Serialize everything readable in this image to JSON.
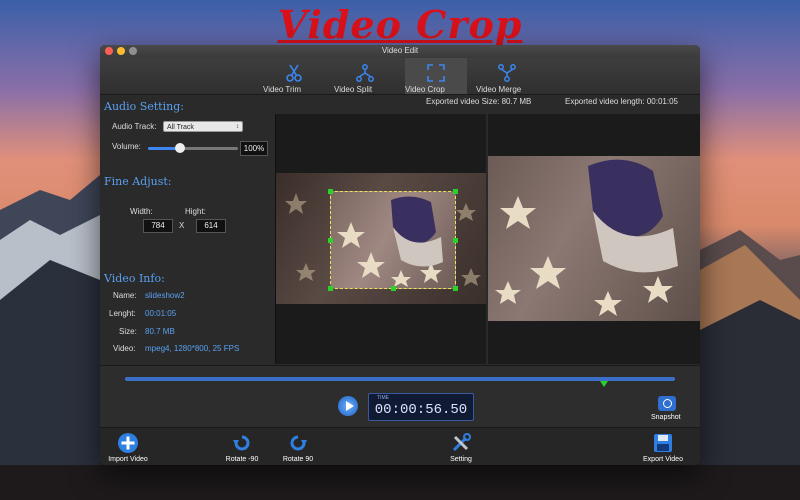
{
  "promo": {
    "title": "Video Crop"
  },
  "window": {
    "title": "Video Edit"
  },
  "tabs": [
    {
      "label": "Video Trim",
      "icon": "scissors-icon",
      "active": false
    },
    {
      "label": "Video Split",
      "icon": "split-icon",
      "active": false
    },
    {
      "label": "Video Crop",
      "icon": "crop-icon",
      "active": true
    },
    {
      "label": "Video Merge",
      "icon": "merge-icon",
      "active": false
    }
  ],
  "export_info": {
    "size": "Exported video Size: 80.7 MB",
    "length": "Exported video length: 00:01:05"
  },
  "audio": {
    "section_title": "Audio Setting:",
    "track_label": "Audio Track:",
    "track_value": "All Track",
    "volume_label": "Volume:",
    "volume_value": "100%",
    "volume_level": 0.35
  },
  "fine_adjust": {
    "section_title": "Fine Adjust:",
    "width_label": "Width:",
    "height_label": "Hight:",
    "width_value": "784",
    "height_value": "614",
    "separator": "X"
  },
  "video_info": {
    "section_title": "Video Info:",
    "name_label": "Name:",
    "name_value": "slideshow2",
    "length_label": "Lenght:",
    "length_value": "00:01:05",
    "size_label": "Size:",
    "size_value": "80.7 MB",
    "video_label": "Video:",
    "video_value": "mpeg4, 1280*800, 25 FPS"
  },
  "timeline": {
    "time_label": "TIME",
    "time_value": "00:00:56.50",
    "marker_position": 0.87
  },
  "snapshot": {
    "label": "Snapshot"
  },
  "bottom": [
    {
      "label": "Import Video",
      "icon": "plus-circle-icon"
    },
    {
      "label": "Rotate -90",
      "icon": "rotate-left-icon"
    },
    {
      "label": "Rotate 90",
      "icon": "rotate-right-icon"
    },
    {
      "label": "Setting",
      "icon": "tools-icon"
    },
    {
      "label": "Export Video",
      "icon": "save-icon"
    }
  ],
  "colors": {
    "accent": "#3b86f0",
    "label_blue": "#5aa0f0",
    "promo_red": "#d9111a",
    "handle_green": "#2bd12b"
  }
}
